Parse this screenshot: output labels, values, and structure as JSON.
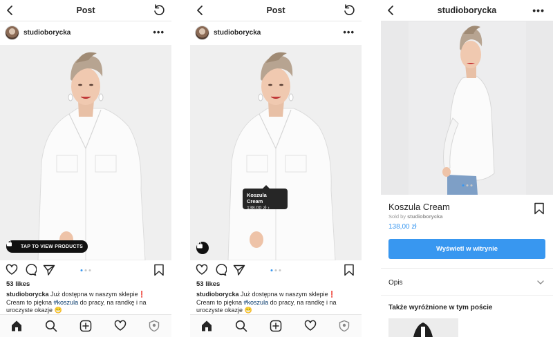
{
  "screen1": {
    "header_title": "Post",
    "username": "studioborycka",
    "tap_label": "TAP TO VIEW PRODUCTS",
    "likes": "53 likes",
    "caption_user": "studioborycka",
    "caption_line1": " Już dostępna w naszym sklepie",
    "caption_mark": "❗",
    "caption_line2a": "Cream to piękna ",
    "caption_hashtag": "#koszula",
    "caption_line2b": " do pracy, na randkę i na",
    "caption_line3": "uroczyste okazje 😁"
  },
  "screen2": {
    "header_title": "Post",
    "username": "studioborycka",
    "product_tag_name": "Koszula Cream",
    "product_tag_price": "138,00 zł",
    "product_tag_chevron": "›",
    "likes": "53 likes",
    "caption_user": "studioborycka",
    "caption_line1": " Już dostępna w naszym sklepie",
    "caption_mark": "❗",
    "caption_line2a": "Cream to piękna ",
    "caption_hashtag": "#koszula",
    "caption_line2b": " do pracy, na randkę i na",
    "caption_line3": "uroczyste okazje 😁"
  },
  "screen3": {
    "header_title": "studioborycka",
    "product_name": "Koszula Cream",
    "sold_by_prefix": "Sold by ",
    "sold_by_name": "studioborycka",
    "price": "138,00 zł",
    "button_label": "Wyświetl w witrynie",
    "description_label": "Opis",
    "also_featured_label": "Także wyróżnione w tym poście"
  },
  "icons": {
    "back": "chevron-left-icon",
    "refresh": "refresh-icon",
    "more": "more-icon",
    "heart": "heart-icon",
    "comment": "comment-icon",
    "share": "share-icon",
    "bookmark": "bookmark-icon",
    "home": "home-icon",
    "search": "search-icon",
    "add": "add-icon",
    "activity": "heart-icon",
    "profile": "profile-icon"
  },
  "colors": {
    "accent": "#3897f0",
    "hashtag": "#003569",
    "text": "#262626",
    "muted": "#8e8e8e"
  }
}
